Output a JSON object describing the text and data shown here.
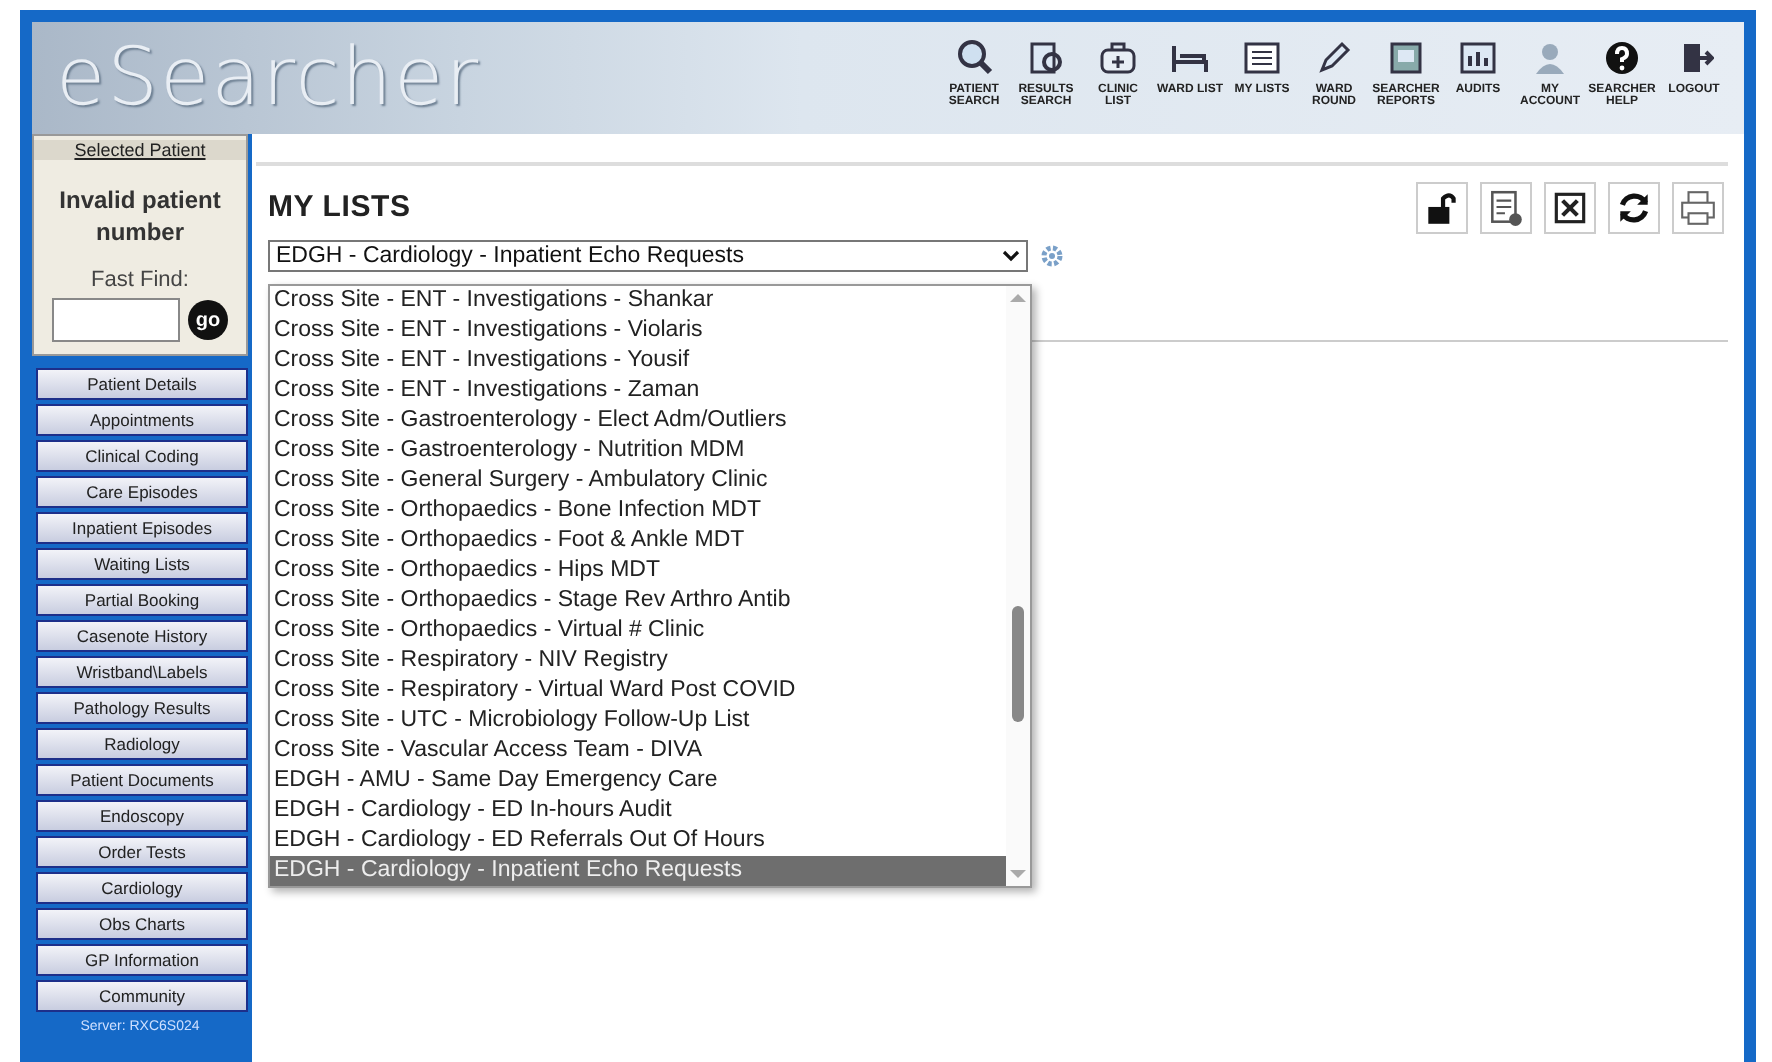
{
  "header": {
    "logo": "eSearcher",
    "nav": [
      {
        "label": "PATIENT SEARCH",
        "kind": "search"
      },
      {
        "label": "RESULTS SEARCH",
        "kind": "results"
      },
      {
        "label": "CLINIC LIST",
        "kind": "clinic"
      },
      {
        "label": "WARD LIST",
        "kind": "bed"
      },
      {
        "label": "MY LISTS",
        "kind": "list"
      },
      {
        "label": "WARD ROUND",
        "kind": "pencil"
      },
      {
        "label": "SEARCHER REPORTS",
        "kind": "report"
      },
      {
        "label": "AUDITS",
        "kind": "chart"
      },
      {
        "label": "MY ACCOUNT",
        "kind": "person"
      },
      {
        "label": "SEARCHER HELP",
        "kind": "help"
      },
      {
        "label": "LOGOUT",
        "kind": "logout"
      }
    ]
  },
  "sidebar": {
    "selected_patient_link": "Selected Patient",
    "patient_status": "Invalid patient number",
    "fast_find_label": "Fast Find:",
    "go_button": "go",
    "menu": [
      "Patient Details",
      "Appointments",
      "Clinical Coding",
      "Care Episodes",
      "Inpatient Episodes",
      "Waiting Lists",
      "Partial Booking",
      "Casenote History",
      "Wristband\\Labels",
      "Pathology Results",
      "Radiology",
      "Patient Documents",
      "Endoscopy",
      "Order Tests",
      "Cardiology",
      "Obs Charts",
      "GP Information",
      "Community"
    ],
    "server": "Server: RXC6S024"
  },
  "main": {
    "title": "MY LISTS",
    "dropdown": {
      "value": "EDGH - Cardiology - Inpatient Echo Requests",
      "options": [
        {
          "label": "Cross Site - ENT - Investigations - Shankar",
          "selected": false
        },
        {
          "label": "Cross Site - ENT - Investigations - Violaris",
          "selected": false
        },
        {
          "label": "Cross Site - ENT - Investigations - Yousif",
          "selected": false
        },
        {
          "label": "Cross Site - ENT - Investigations - Zaman",
          "selected": false
        },
        {
          "label": "Cross Site - Gastroenterology - Elect Adm/Outliers",
          "selected": false
        },
        {
          "label": "Cross Site - Gastroenterology - Nutrition MDM",
          "selected": false
        },
        {
          "label": "Cross Site - General Surgery - Ambulatory Clinic",
          "selected": false
        },
        {
          "label": "Cross Site - Orthopaedics - Bone Infection MDT",
          "selected": false
        },
        {
          "label": "Cross Site - Orthopaedics - Foot & Ankle MDT",
          "selected": false
        },
        {
          "label": "Cross Site - Orthopaedics - Hips MDT",
          "selected": false
        },
        {
          "label": "Cross Site - Orthopaedics - Stage Rev Arthro Antib",
          "selected": false
        },
        {
          "label": "Cross Site - Orthopaedics - Virtual # Clinic",
          "selected": false
        },
        {
          "label": "Cross Site - Respiratory - NIV Registry",
          "selected": false
        },
        {
          "label": "Cross Site - Respiratory - Virtual Ward Post COVID",
          "selected": false
        },
        {
          "label": "Cross Site - UTC - Microbiology Follow-Up List",
          "selected": false
        },
        {
          "label": "Cross Site - Vascular Access Team - DIVA",
          "selected": false
        },
        {
          "label": "EDGH - AMU - Same Day Emergency Care",
          "selected": false
        },
        {
          "label": "EDGH - Cardiology - ED In-hours Audit",
          "selected": false
        },
        {
          "label": "EDGH - Cardiology - ED Referrals Out Of Hours",
          "selected": false
        },
        {
          "label": "EDGH - Cardiology - Inpatient Echo Requests",
          "selected": true
        }
      ]
    },
    "tools": [
      {
        "kind": "lock"
      },
      {
        "kind": "settings"
      },
      {
        "kind": "close"
      },
      {
        "kind": "refresh"
      },
      {
        "kind": "print"
      }
    ]
  }
}
